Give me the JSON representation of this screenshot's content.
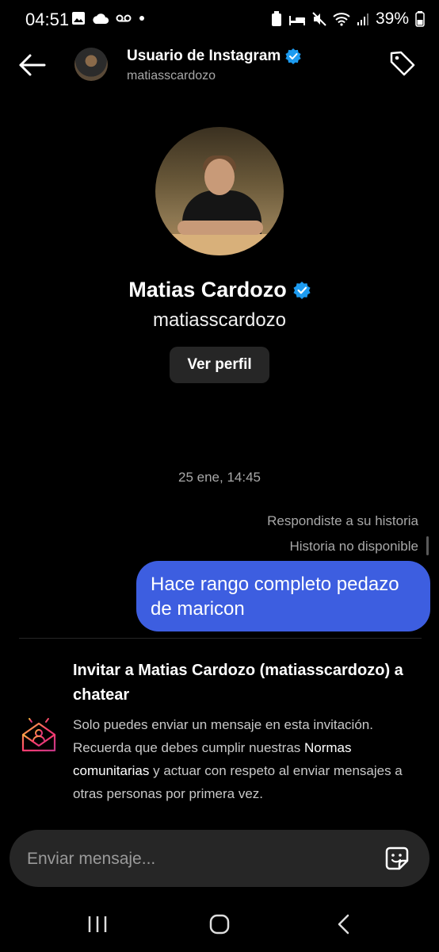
{
  "status_bar": {
    "time": "04:51",
    "battery": "39%"
  },
  "header": {
    "title": "Usuario de Instagram",
    "subtitle": "matiasscardozo",
    "icons": [
      "back-arrow-icon",
      "verified-badge-icon",
      "tag-icon"
    ]
  },
  "profile": {
    "name": "Matias Cardozo",
    "username": "matiasscardozo",
    "view_profile_label": "Ver perfil"
  },
  "chat": {
    "date": "25 ene, 14:45",
    "reply_note": "Respondiste a su historia",
    "story_unavailable": "Historia no disponible",
    "message": "Hace rango completo pedazo de maricon",
    "bubble_color": "#3d5ee0"
  },
  "invite": {
    "title": "Invitar a Matias Cardozo (matiasscardozo) a chatear",
    "body_1": "Solo puedes enviar un mensaje en esta invitación. Recuerda que debes cumplir nuestras ",
    "link": "Normas comunitarias",
    "body_2": " y actuar con respeto al enviar mensajes a otras personas por primera vez."
  },
  "composer": {
    "placeholder": "Enviar mensaje..."
  },
  "colors": {
    "background": "#000000",
    "verified": "#1d9bf0",
    "input_bg": "#262626"
  }
}
